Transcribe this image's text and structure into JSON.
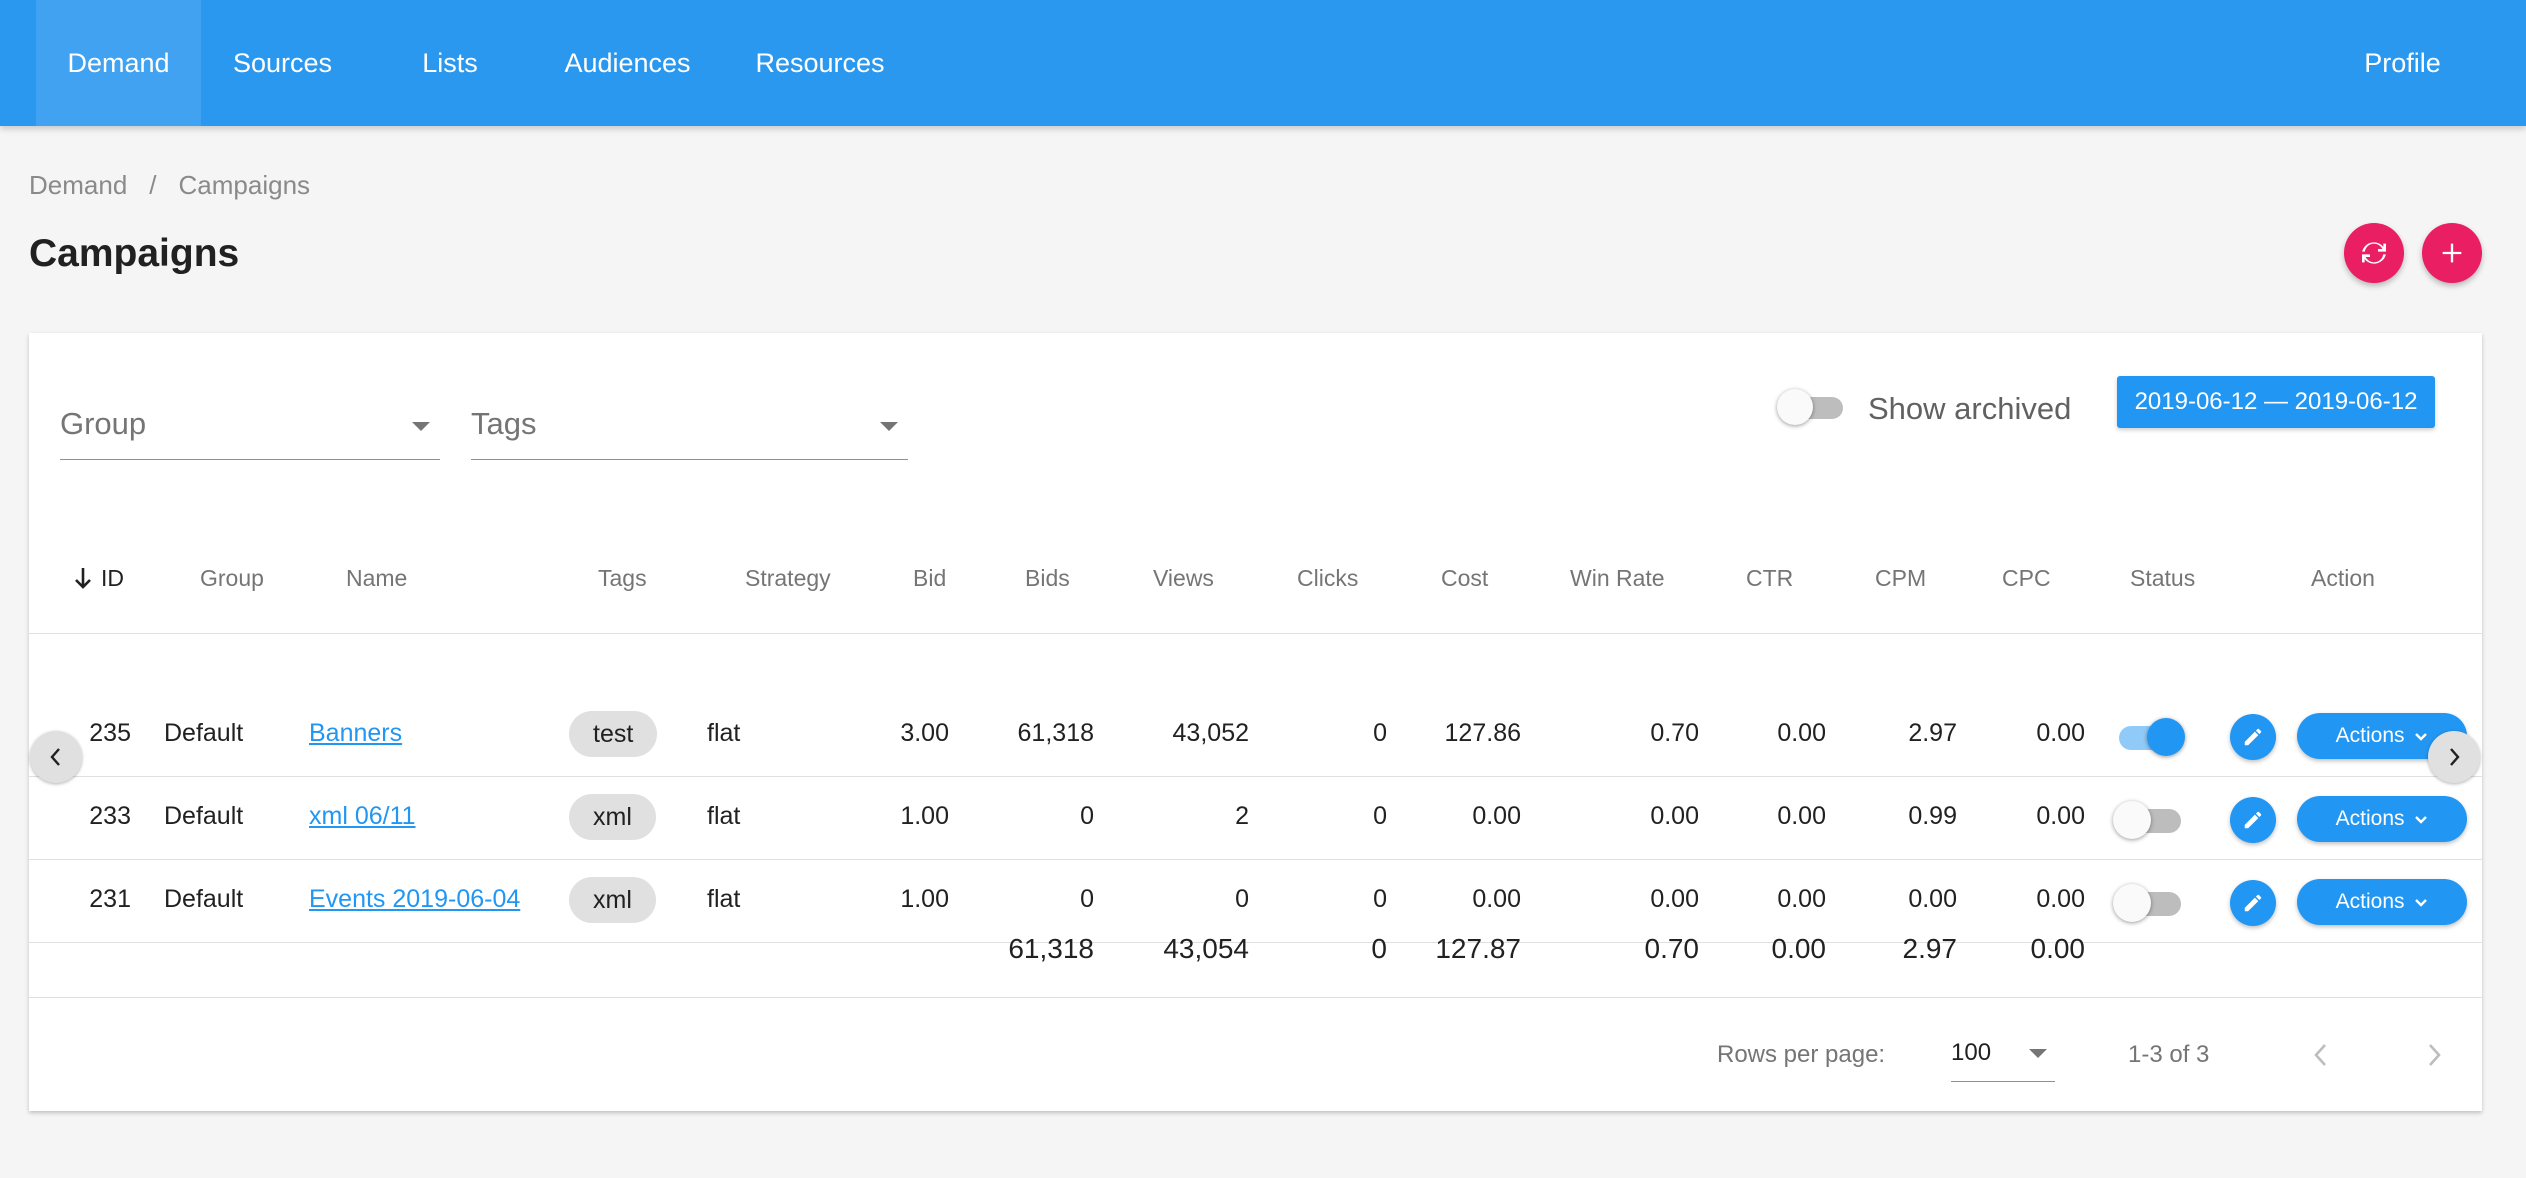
{
  "nav": {
    "items": [
      {
        "label": "Demand"
      },
      {
        "label": "Sources"
      },
      {
        "label": "Lists"
      },
      {
        "label": "Audiences"
      },
      {
        "label": "Resources"
      }
    ],
    "profile": "Profile"
  },
  "breadcrumb": {
    "root": "Demand",
    "separator": "/",
    "current": "Campaigns"
  },
  "page_title": "Campaigns",
  "filters": {
    "group_placeholder": "Group",
    "tags_placeholder": "Tags",
    "show_archived_label": "Show archived",
    "show_archived": false,
    "date_range": "2019-06-12 — 2019-06-12"
  },
  "table": {
    "headers": [
      "ID",
      "Group",
      "Name",
      "Tags",
      "Strategy",
      "Bid",
      "Bids",
      "Views",
      "Clicks",
      "Cost",
      "Win Rate",
      "CTR",
      "CPM",
      "CPC",
      "Status",
      "Action"
    ],
    "sort_column": "ID",
    "rows": [
      {
        "id": "235",
        "group": "Default",
        "name": "Banners",
        "tag": "test",
        "strategy": "flat",
        "bid": "3.00",
        "bids": "61,318",
        "views": "43,052",
        "clicks": "0",
        "cost": "127.86",
        "win_rate": "0.70",
        "ctr": "0.00",
        "cpm": "2.97",
        "cpc": "0.00",
        "status_on": true,
        "action": "Actions"
      },
      {
        "id": "233",
        "group": "Default",
        "name": "xml 06/11",
        "tag": "xml",
        "strategy": "flat",
        "bid": "1.00",
        "bids": "0",
        "views": "2",
        "clicks": "0",
        "cost": "0.00",
        "win_rate": "0.00",
        "ctr": "0.00",
        "cpm": "0.99",
        "cpc": "0.00",
        "status_on": false,
        "action": "Actions"
      },
      {
        "id": "231",
        "group": "Default",
        "name": "Events 2019-06-04",
        "tag": "xml",
        "strategy": "flat",
        "bid": "1.00",
        "bids": "0",
        "views": "0",
        "clicks": "0",
        "cost": "0.00",
        "win_rate": "0.00",
        "ctr": "0.00",
        "cpm": "0.00",
        "cpc": "0.00",
        "status_on": false,
        "action": "Actions"
      }
    ],
    "totals": {
      "bids": "61,318",
      "views": "43,054",
      "clicks": "0",
      "cost": "127.87",
      "win_rate": "0.70",
      "ctr": "0.00",
      "cpm": "2.97",
      "cpc": "0.00"
    }
  },
  "pagination": {
    "rows_per_page_label": "Rows per page:",
    "rows_per_page": "100",
    "range": "1-3 of 3"
  },
  "colors": {
    "primary": "#2b98f0",
    "accent": "#e91e63",
    "button": "#2196f3"
  },
  "icons": [
    "arrow-down-icon",
    "refresh-icon",
    "plus-icon",
    "pencil-icon",
    "chevron-down-icon",
    "chevron-left-icon",
    "chevron-right-icon"
  ]
}
